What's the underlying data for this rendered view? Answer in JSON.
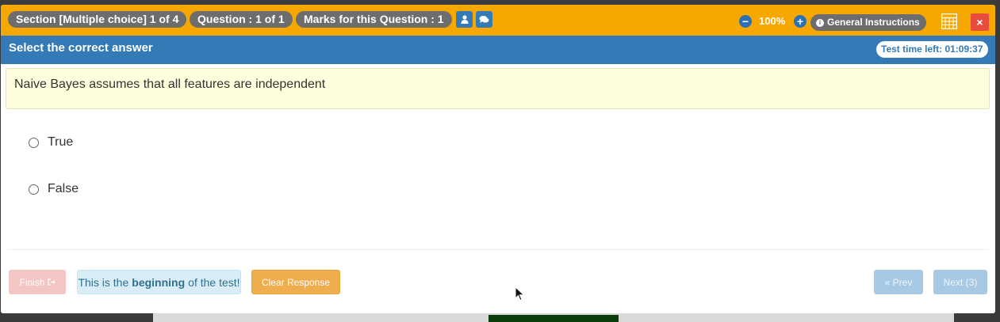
{
  "topbar": {
    "section_label": "Section [Multiple choice] 1 of 4",
    "question_label": "Question : 1 of 1",
    "marks_label": "Marks for this Question : 1",
    "zoom_level": "100%",
    "general_instructions": "General Instructions",
    "close_label": "×",
    "icons": [
      "user-icon",
      "comments-icon",
      "zoom-out-icon",
      "zoom-in-icon",
      "info-icon",
      "calculator-icon",
      "close-icon"
    ]
  },
  "header": {
    "title": "Select the correct answer",
    "timer": "Test time left: 01:09:37"
  },
  "question": {
    "text": "Naive Bayes assumes that all features are independent"
  },
  "options": [
    {
      "label": "True",
      "selected": false
    },
    {
      "label": "False",
      "selected": false
    }
  ],
  "footer": {
    "finish_label": "Finish",
    "notice_prefix": "This is the",
    "notice_bold": "beginning",
    "notice_suffix": "of the test!",
    "clear_label": "Clear Response",
    "prev_label": "« Prev",
    "next_label": "Next (3)"
  },
  "colors": {
    "topbar": "#f6a800",
    "header": "#337ab7",
    "pill": "#6d6d6d",
    "question_bg": "#fefedd",
    "clear_button": "#f0ad4e",
    "close_button": "#e74c3c"
  }
}
